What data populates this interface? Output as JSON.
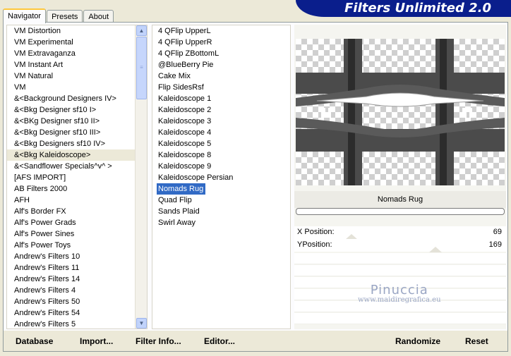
{
  "app": {
    "title": "Filters Unlimited 2.0"
  },
  "tabs": [
    {
      "label": "Navigator",
      "active": true
    },
    {
      "label": "Presets",
      "active": false
    },
    {
      "label": "About",
      "active": false
    }
  ],
  "categories": [
    "VM Distortion",
    "VM Experimental",
    "VM Extravaganza",
    "VM Instant Art",
    "VM Natural",
    "VM",
    "&<Background Designers IV>",
    "&<Bkg Designer sf10 I>",
    "&<BKg Designer sf10 II>",
    "&<Bkg Designer sf10 III>",
    "&<Bkg Designers sf10 IV>",
    "&<Bkg Kaleidoscope>",
    "&<Sandflower Specials^v^ >",
    "[AFS IMPORT]",
    "AB Filters 2000",
    "AFH",
    "Alf's Border FX",
    "Alf's Power Grads",
    "Alf's Power Sines",
    "Alf's Power Toys",
    "Andrew's Filters 10",
    "Andrew's Filters 11",
    "Andrew's Filters 14",
    "Andrew's Filters 4",
    "Andrew's Filters 50",
    "Andrew's Filters 54",
    "Andrew's Filters 5"
  ],
  "selected_category": "&<Bkg Kaleidoscope>",
  "filters": [
    "4 QFlip UpperL",
    "4 QFlip UpperR",
    "4 QFlip ZBottomL",
    "@BlueBerry Pie",
    "Cake Mix",
    "Flip SidesRsf",
    "Kaleidoscope 1",
    "Kaleidoscope 2",
    "Kaleidoscope 3",
    "Kaleidoscope 4",
    "Kaleidoscope 5",
    "Kaleidoscope 8",
    "Kaleidoscope 9",
    "Kaleidoscope Persian",
    "Nomads Rug",
    "Quad Flip",
    "Sands Plaid",
    "Swirl Away"
  ],
  "selected_filter": "Nomads Rug",
  "filter_name": "Nomads Rug",
  "params": [
    {
      "label": "X Position:",
      "value": "69"
    },
    {
      "label": "YPosition:",
      "value": "169"
    }
  ],
  "watermark": {
    "line1": "Pinuccia",
    "line2": "www.maidiregrafica.eu"
  },
  "buttons": {
    "database": "Database",
    "import": "Import...",
    "filter_info": "Filter Info...",
    "editor": "Editor...",
    "randomize": "Randomize",
    "reset": "Reset"
  },
  "icons": {
    "scroll_up": "chevron-up-icon",
    "scroll_down": "chevron-down-icon"
  },
  "colors": {
    "banner": "#0a1e8c",
    "selection": "#316ac5",
    "tab_highlight": "#ffc83c"
  }
}
